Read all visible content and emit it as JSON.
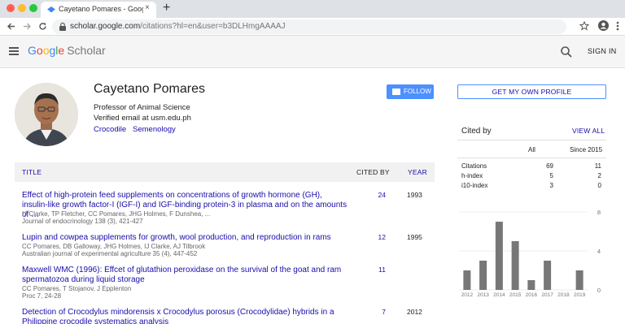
{
  "browser": {
    "tab_title": "Cayetano Pomares - Google Sch",
    "tab_close": "×",
    "new_tab": "+",
    "url_host": "scholar.google.com",
    "url_path": "/citations?hl=en&user=b3DLHmgAAAAJ",
    "icons": [
      "back-icon",
      "forward-icon",
      "reload-icon",
      "lock-icon",
      "star-icon",
      "account-icon",
      "more-icon"
    ]
  },
  "header": {
    "logo_google": "Google",
    "logo_scholar": "Scholar",
    "signin": "SIGN IN",
    "google_colors": [
      "#4285f4",
      "#ea4335",
      "#fbbc05",
      "#4285f4",
      "#34a853",
      "#ea4335"
    ]
  },
  "profile": {
    "name": "Cayetano Pomares",
    "affiliation": "Professor of Animal Science",
    "email": "Verified email at usm.edu.ph",
    "interests": [
      "Crocodile",
      "Semenology"
    ],
    "follow_label": "FOLLOW",
    "get_profile_label": "GET MY OWN PROFILE"
  },
  "table": {
    "col_title": "TITLE",
    "col_cited": "CITED BY",
    "col_year": "YEAR",
    "rows": [
      {
        "title": "Effect of high-protein feed supplements on concentrations of growth hormone (GH), insulin-like growth factor-I (IGF-I) and IGF-binding protein-3 in plasma and on the amounts of …",
        "authors": "IJ Clarke, TP Fletcher, CC Pomares, JHG Holmes, F Dunshea, ...",
        "journal": "Journal of endocrinology 138 (3), 421-427",
        "cited": "24",
        "year": "1993"
      },
      {
        "title": "Lupin and cowpea supplements for growth, wool production, and reproduction in rams",
        "authors": "CC Pomares, DB Galloway, JHG Holmes, IJ Clarke, AJ Tilbrook",
        "journal": "Australian journal of experimental agriculture 35 (4), 447-452",
        "cited": "12",
        "year": "1995"
      },
      {
        "title": "Maxwell WMC (1996): Effcet of glutathion peroxidase on the survival of the goat and ram spermatozoa during liquid storage",
        "authors": "CC Pomares, T Stojanov, J Epplenton",
        "journal": "Proc 7, 24-28",
        "cited": "11",
        "year": ""
      },
      {
        "title": "Detection of Crocodylus mindorensis x Crocodylus porosus (Crocodylidae) hybrids in a Philippine crocodile systematics analysis",
        "authors": "",
        "journal": "",
        "cited": "7",
        "year": "2012"
      }
    ]
  },
  "cited_by": {
    "title": "Cited by",
    "view_all": "VIEW ALL",
    "col_all": "All",
    "col_since": "Since 2015",
    "metrics": [
      {
        "label": "Citations",
        "all": "69",
        "since": "11"
      },
      {
        "label": "h-index",
        "all": "5",
        "since": "2"
      },
      {
        "label": "i10-index",
        "all": "3",
        "since": "0"
      }
    ]
  },
  "chart_data": {
    "type": "bar",
    "categories": [
      "2012",
      "2013",
      "2014",
      "2015",
      "2016",
      "2017",
      "2018",
      "2019"
    ],
    "values": [
      2,
      3,
      7,
      5,
      1,
      3,
      0,
      2
    ],
    "yticks": [
      "8",
      "4",
      "0"
    ],
    "ylim": [
      0,
      8
    ],
    "bar_color": "#777777",
    "grid": true
  }
}
